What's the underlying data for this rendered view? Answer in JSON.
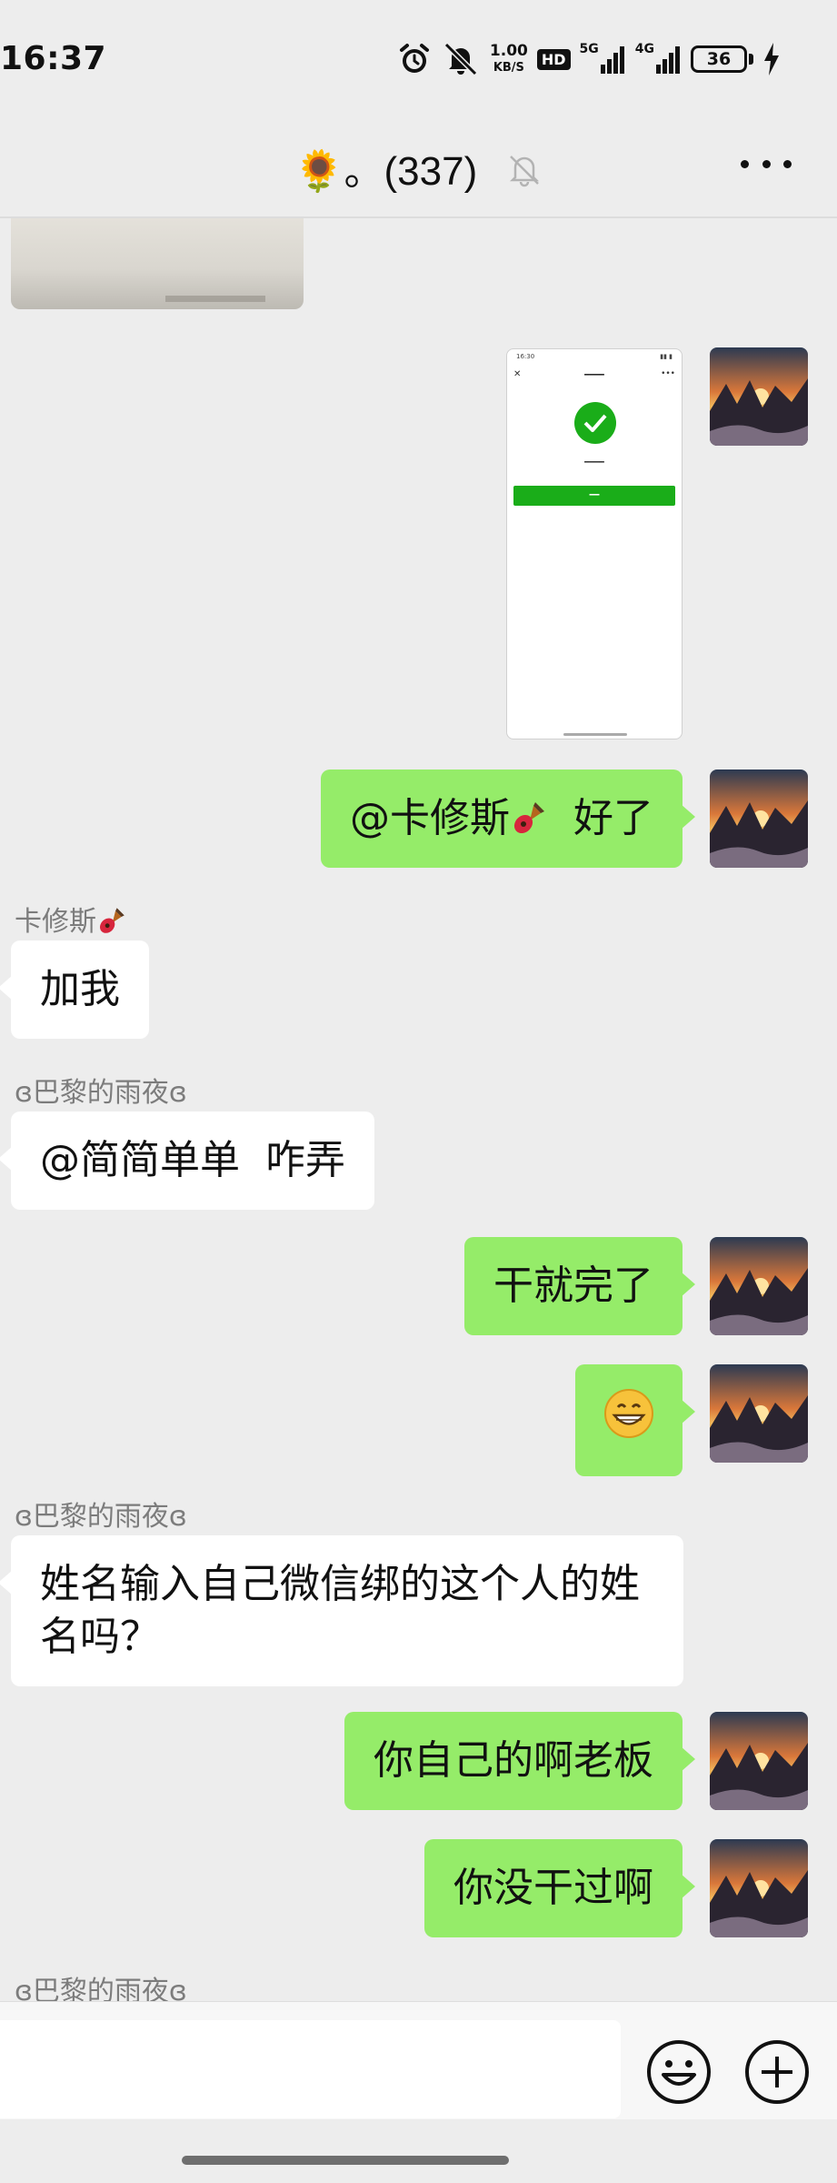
{
  "status_bar": {
    "time": "16:37",
    "net_speed_value": "1.00",
    "net_speed_unit": "KB/S",
    "hd_label": "HD",
    "signal1_label": "5G",
    "signal2_label": "4G",
    "battery_level": "36",
    "icons": [
      "alarm-icon",
      "mute-icon",
      "hd-icon",
      "signal-icon",
      "battery-icon",
      "charging-icon"
    ]
  },
  "header": {
    "title": "🌻。(337)",
    "icons": [
      "mute-icon",
      "more-icon"
    ]
  },
  "messages": {
    "m1": {
      "sender": "me",
      "mention": "@卡修斯",
      "text": "好了"
    },
    "m2": {
      "sender_name": "卡修斯",
      "text": "加我"
    },
    "m3": {
      "sender_name": "ɞ巴黎的雨夜ɞ",
      "text": "@简简单单  咋弄"
    },
    "m4": {
      "sender": "me",
      "text": "干就完了"
    },
    "m5": {
      "sender": "me",
      "emoji": "😁"
    },
    "m6": {
      "sender_name": "ɞ巴黎的雨夜ɞ",
      "text": "姓名输入自己微信绑的这个人的姓名吗？"
    },
    "m7": {
      "sender": "me",
      "text": "你自己的啊老板"
    },
    "m8": {
      "sender": "me",
      "text": "你没干过啊"
    },
    "m9": {
      "sender_name": "ɞ巴黎的雨夜ɞ"
    }
  },
  "input_bar": {
    "placeholder": "",
    "icons": [
      "emoji-icon",
      "plus-icon"
    ]
  },
  "colors": {
    "background": "#ededed",
    "my_bubble": "#95ec69",
    "other_bubble": "#ffffff",
    "accent_green": "#1aad19"
  }
}
